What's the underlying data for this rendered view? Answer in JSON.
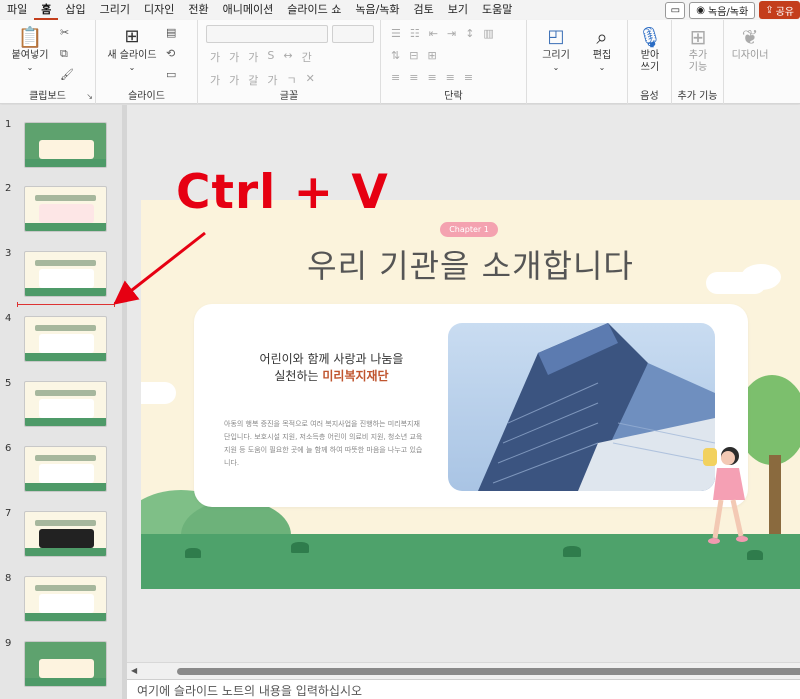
{
  "menu": {
    "tabs": [
      "파일",
      "홈",
      "삽입",
      "그리기",
      "디자인",
      "전환",
      "애니메이션",
      "슬라이드 쇼",
      "녹음/녹화",
      "검토",
      "보기",
      "도움말"
    ],
    "active_tab": "홈",
    "record_label": "녹음/녹화",
    "share_label": "공유"
  },
  "ribbon": {
    "groups": {
      "clipboard": "클립보드",
      "slides": "슬라이드",
      "font": "글꼴",
      "paragraph": "단락",
      "voice": "음성",
      "addins": "추가 기능"
    },
    "paste_label": "붙여넣기",
    "new_slide_label": "새 슬라이드",
    "draw_label": "그리기",
    "edit_label": "편집",
    "dictate_label": "받아\n쓰기",
    "addins_label": "추가\n기능",
    "designer_label": "디자이너"
  },
  "thumbnails": {
    "numbers": [
      "1",
      "2",
      "3",
      "4",
      "5",
      "6",
      "7",
      "8",
      "9"
    ],
    "titles": [
      "높은 기관",
      "INDEX",
      "우리 기관을 소개합니다",
      "핵심 가치 개념",
      "핵심 가치/성과",
      "사업 안내",
      "연구 영화 기록",
      "우리 가 추구 가는 이미",
      "호정은 과정적 안내"
    ]
  },
  "slide": {
    "chapter": "Chapter 1",
    "title": "우리 기관을 소개합니다",
    "heading_line1": "어린이와 함께 사랑과 나눔을",
    "heading_line2_prefix": "실천하는 ",
    "heading_line2_accent": "미리복지재단",
    "body": "아동의 행복 증진을 목적으로 여러 복지사업을 진행하는 미리복지재단입니다. 보호시설 지원, 저소득층 어린이 의료비 지원, 청소년 교육지원 등 도움이 필요한 곳에 늘 함께 하여 따뜻한 마음을 나누고 있습니다.",
    "colors": {
      "accent": "#c0552f",
      "pill": "#f4a2b0",
      "ground": "#4ea26b",
      "background": "#fbf3dc"
    }
  },
  "annotation": {
    "text": "Ctrl + V",
    "color": "#e60012"
  },
  "notes": {
    "placeholder": "여기에 슬라이드 노트의 내용을 입력하십시오"
  }
}
